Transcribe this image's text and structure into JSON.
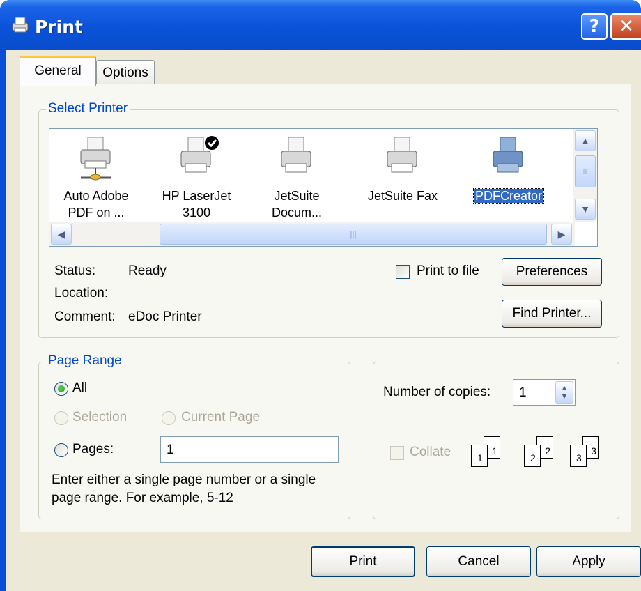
{
  "window": {
    "title": "Print",
    "help_glyph": "?",
    "close_glyph": "✕"
  },
  "tabs": [
    {
      "label": "General",
      "active": true
    },
    {
      "label": "Options",
      "active": false
    }
  ],
  "select_printer": {
    "legend": "Select Printer",
    "printers": [
      {
        "line1": "Auto Adobe",
        "line2": "PDF on ...",
        "icon": "network-printer-icon"
      },
      {
        "line1": "HP LaserJet",
        "line2": "3100",
        "icon": "default-printer-icon",
        "default": true
      },
      {
        "line1": "JetSuite",
        "line2": "Docum...",
        "icon": "printer-icon"
      },
      {
        "line1": "JetSuite Fax",
        "line2": "",
        "icon": "printer-icon"
      },
      {
        "line1": "PDFCreator",
        "line2": "",
        "icon": "printer-icon",
        "selected": true
      }
    ],
    "status_label": "Status:",
    "status_value": "Ready",
    "location_label": "Location:",
    "location_value": "",
    "comment_label": "Comment:",
    "comment_value": "eDoc Printer",
    "print_to_file_label": "Print to file",
    "print_to_file_checked": false,
    "preferences_label": "Preferences",
    "find_printer_label": "Find Printer..."
  },
  "page_range": {
    "legend": "Page Range",
    "all_label": "All",
    "selection_label": "Selection",
    "current_page_label": "Current Page",
    "pages_label": "Pages:",
    "pages_value": "1",
    "selected": "All",
    "hint_line1": "Enter either a single page number or a single",
    "hint_line2": "page range.  For example, 5-12"
  },
  "copies": {
    "label": "Number of copies:",
    "value": "1",
    "collate_label": "Collate",
    "collate_checked": false
  },
  "buttons": {
    "print": "Print",
    "cancel": "Cancel",
    "apply": "Apply"
  }
}
